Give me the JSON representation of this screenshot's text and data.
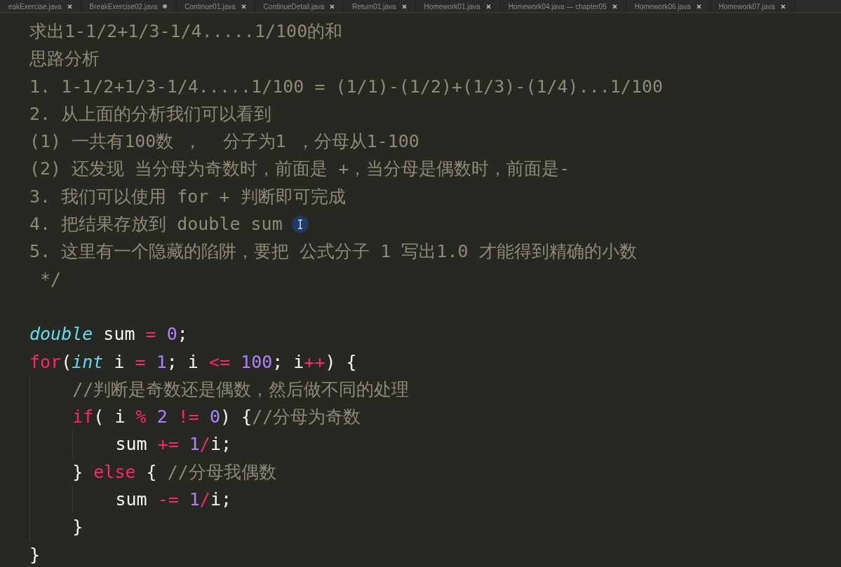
{
  "tabs": [
    {
      "label": "eakExercise.java",
      "modified": false
    },
    {
      "label": "BreakExercise02.java",
      "modified": true
    },
    {
      "label": "Continue01.java",
      "modified": false
    },
    {
      "label": "ContinueDetail.java",
      "modified": false
    },
    {
      "label": "Return01.java",
      "modified": false
    },
    {
      "label": "Homework01.java",
      "modified": false
    },
    {
      "label": "Homework04.java — chapter05",
      "modified": false
    },
    {
      "label": "Homework06.java",
      "modified": false
    },
    {
      "label": "Homework07.java",
      "modified": false
    }
  ],
  "editor": {
    "comment_lines": [
      {
        "tokens": [
          {
            "kind": "comment",
            "text": "求出1-1/2+1/3-1/4.....1/100的和"
          }
        ]
      },
      {
        "tokens": [
          {
            "kind": "comment",
            "text": "思路分析"
          }
        ]
      },
      {
        "tokens": [
          {
            "kind": "comment",
            "text": "1. 1-1/2+1/3-1/4.....1/100 = (1/1)-(1/2)+(1/3)-(1/4)...1/100"
          }
        ]
      },
      {
        "tokens": [
          {
            "kind": "comment",
            "text": "2. 从上面的分析我们可以看到"
          }
        ]
      },
      {
        "tokens": [
          {
            "kind": "comment",
            "text": "(1) 一共有100数 ，  分子为1 ，分母从1-100"
          }
        ]
      },
      {
        "tokens": [
          {
            "kind": "comment",
            "text": "(2) 还发现 当分母为奇数时，前面是 +，当分母是偶数时，前面是-"
          }
        ]
      },
      {
        "tokens": [
          {
            "kind": "comment",
            "text": "3. 我们可以使用 for + 判断即可完成"
          }
        ]
      },
      {
        "tokens": [
          {
            "kind": "comment",
            "text": "4. 把结果存放到 double sum"
          }
        ],
        "cursor": true
      },
      {
        "tokens": [
          {
            "kind": "comment",
            "text": "5. 这里有一个隐藏的陷阱，要把 公式分子 1 写出1.0 才能得到精确的小数"
          }
        ]
      },
      {
        "tokens": [
          {
            "kind": "comment",
            "text": " */"
          }
        ]
      }
    ],
    "code_lines": [
      {
        "tokens": [
          {
            "kind": "type",
            "text": "double"
          },
          {
            "kind": "plain",
            "text": " sum "
          },
          {
            "kind": "op",
            "text": "= "
          },
          {
            "kind": "number",
            "text": "0"
          },
          {
            "kind": "plain",
            "text": ";"
          }
        ]
      },
      {
        "tokens": [
          {
            "kind": "keyword",
            "text": "for"
          },
          {
            "kind": "plain",
            "text": "("
          },
          {
            "kind": "type",
            "text": "int"
          },
          {
            "kind": "plain",
            "text": " i "
          },
          {
            "kind": "op",
            "text": "= "
          },
          {
            "kind": "number",
            "text": "1"
          },
          {
            "kind": "plain",
            "text": "; i "
          },
          {
            "kind": "op",
            "text": "<= "
          },
          {
            "kind": "number",
            "text": "100"
          },
          {
            "kind": "plain",
            "text": "; i"
          },
          {
            "kind": "op",
            "text": "++"
          },
          {
            "kind": "plain",
            "text": ") {"
          }
        ],
        "children": [
          {
            "tokens": [
              {
                "kind": "comment",
                "text": "//判断是奇数还是偶数，然后做不同的处理"
              }
            ]
          },
          {
            "tokens": [
              {
                "kind": "keyword",
                "text": "if"
              },
              {
                "kind": "plain",
                "text": "( i "
              },
              {
                "kind": "op",
                "text": "% "
              },
              {
                "kind": "number",
                "text": "2"
              },
              {
                "kind": "op",
                "text": " != "
              },
              {
                "kind": "number",
                "text": "0"
              },
              {
                "kind": "plain",
                "text": ") {"
              },
              {
                "kind": "comment",
                "text": "//分母为奇数"
              }
            ],
            "children": [
              {
                "tokens": [
                  {
                    "kind": "plain",
                    "text": "sum "
                  },
                  {
                    "kind": "op",
                    "text": "+= "
                  },
                  {
                    "kind": "number",
                    "text": "1"
                  },
                  {
                    "kind": "op",
                    "text": "/"
                  },
                  {
                    "kind": "plain",
                    "text": "i;"
                  }
                ]
              }
            ]
          },
          {
            "tokens": [
              {
                "kind": "plain",
                "text": "} "
              },
              {
                "kind": "keyword",
                "text": "else"
              },
              {
                "kind": "plain",
                "text": " { "
              },
              {
                "kind": "comment",
                "text": "//分母我偶数"
              }
            ],
            "children": [
              {
                "tokens": [
                  {
                    "kind": "plain",
                    "text": "sum "
                  },
                  {
                    "kind": "op",
                    "text": "-= "
                  },
                  {
                    "kind": "number",
                    "text": "1"
                  },
                  {
                    "kind": "op",
                    "text": "/"
                  },
                  {
                    "kind": "plain",
                    "text": "i;"
                  }
                ]
              }
            ]
          },
          {
            "tokens": [
              {
                "kind": "plain",
                "text": "}"
              }
            ]
          }
        ]
      },
      {
        "tokens": [
          {
            "kind": "plain",
            "text": "}"
          }
        ]
      }
    ]
  }
}
